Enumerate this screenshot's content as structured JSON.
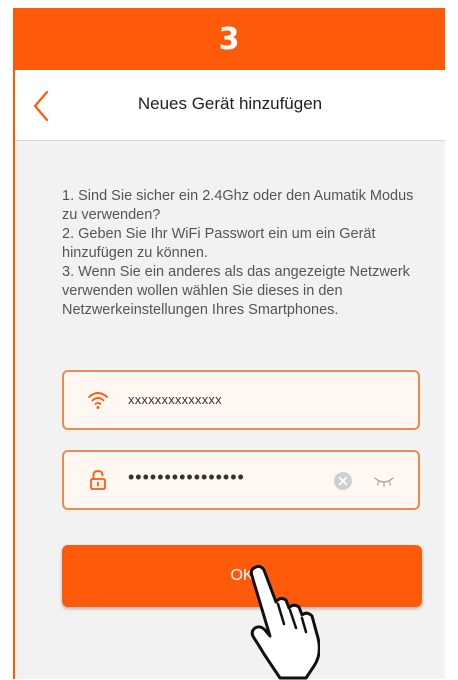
{
  "step": {
    "number": "3"
  },
  "header": {
    "title": "Neues Gerät hinzufügen"
  },
  "instructions": [
    "1. Sind Sie sicher ein 2.4Ghz oder den Aumatik Modus zu verwenden?",
    "2. Geben Sie Ihr WiFi Passwort ein um ein Gerät hinzufügen zu können.",
    "3. Wenn Sie ein anderes als das angezeigte Netzwerk verwenden wollen wählen Sie dieses in den Netzwerkeinstellungen Ihres Smartphones."
  ],
  "form": {
    "ssid_value": "xxxxxxxxxxxxxx",
    "password_value": "••••••••••••••••",
    "ok_label": "OK"
  },
  "colors": {
    "accent": "#ff5a0a",
    "field_border": "#f08a4b",
    "background": "#f2f2f2"
  },
  "icons": [
    "back-arrow-icon",
    "wifi-icon",
    "lock-icon",
    "clear-icon",
    "eye-closed-icon",
    "hand-pointer-icon"
  ]
}
